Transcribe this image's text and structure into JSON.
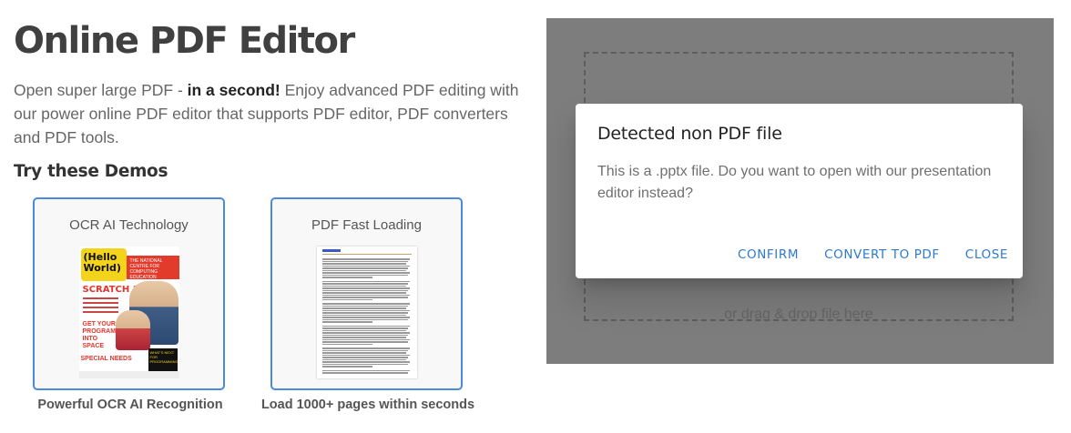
{
  "header": {
    "title": "Online PDF Editor",
    "intro_start": "Open super large PDF - ",
    "intro_bold": "in a second!",
    "intro_end": " Enjoy advanced PDF editing with our power online PDF editor that supports PDF editor, PDF converters and PDF tools."
  },
  "demos": {
    "heading": "Try these Demos",
    "cards": [
      {
        "title": "OCR AI Technology",
        "caption": "Powerful OCR AI Recognition"
      },
      {
        "title": "PDF Fast Loading",
        "caption": "Load 1000+ pages within seconds"
      }
    ]
  },
  "magazine": {
    "logo": "(Hello World)",
    "band": "THE NATIONAL CENTRE FOR COMPUTING EDUCATION",
    "feature": "SCRATCH 3",
    "program": "GET YOUR PROGRAM INTO SPACE",
    "special": "SPECIAL NEEDS",
    "promo": "WHAT'S NEXT FOR PROGRAMMING"
  },
  "upload": {
    "drop_hint": "or drag & drop file here"
  },
  "dialog": {
    "title": "Detected non PDF file",
    "message": "This is a .pptx file. Do you want to open with our presentation editor instead?",
    "buttons": {
      "confirm": "CONFIRM",
      "convert": "CONVERT TO PDF",
      "close": "CLOSE"
    }
  },
  "colors": {
    "accent": "#2f7ac9",
    "card_border": "#4a89dc",
    "overlay": "#7d7d7d"
  }
}
